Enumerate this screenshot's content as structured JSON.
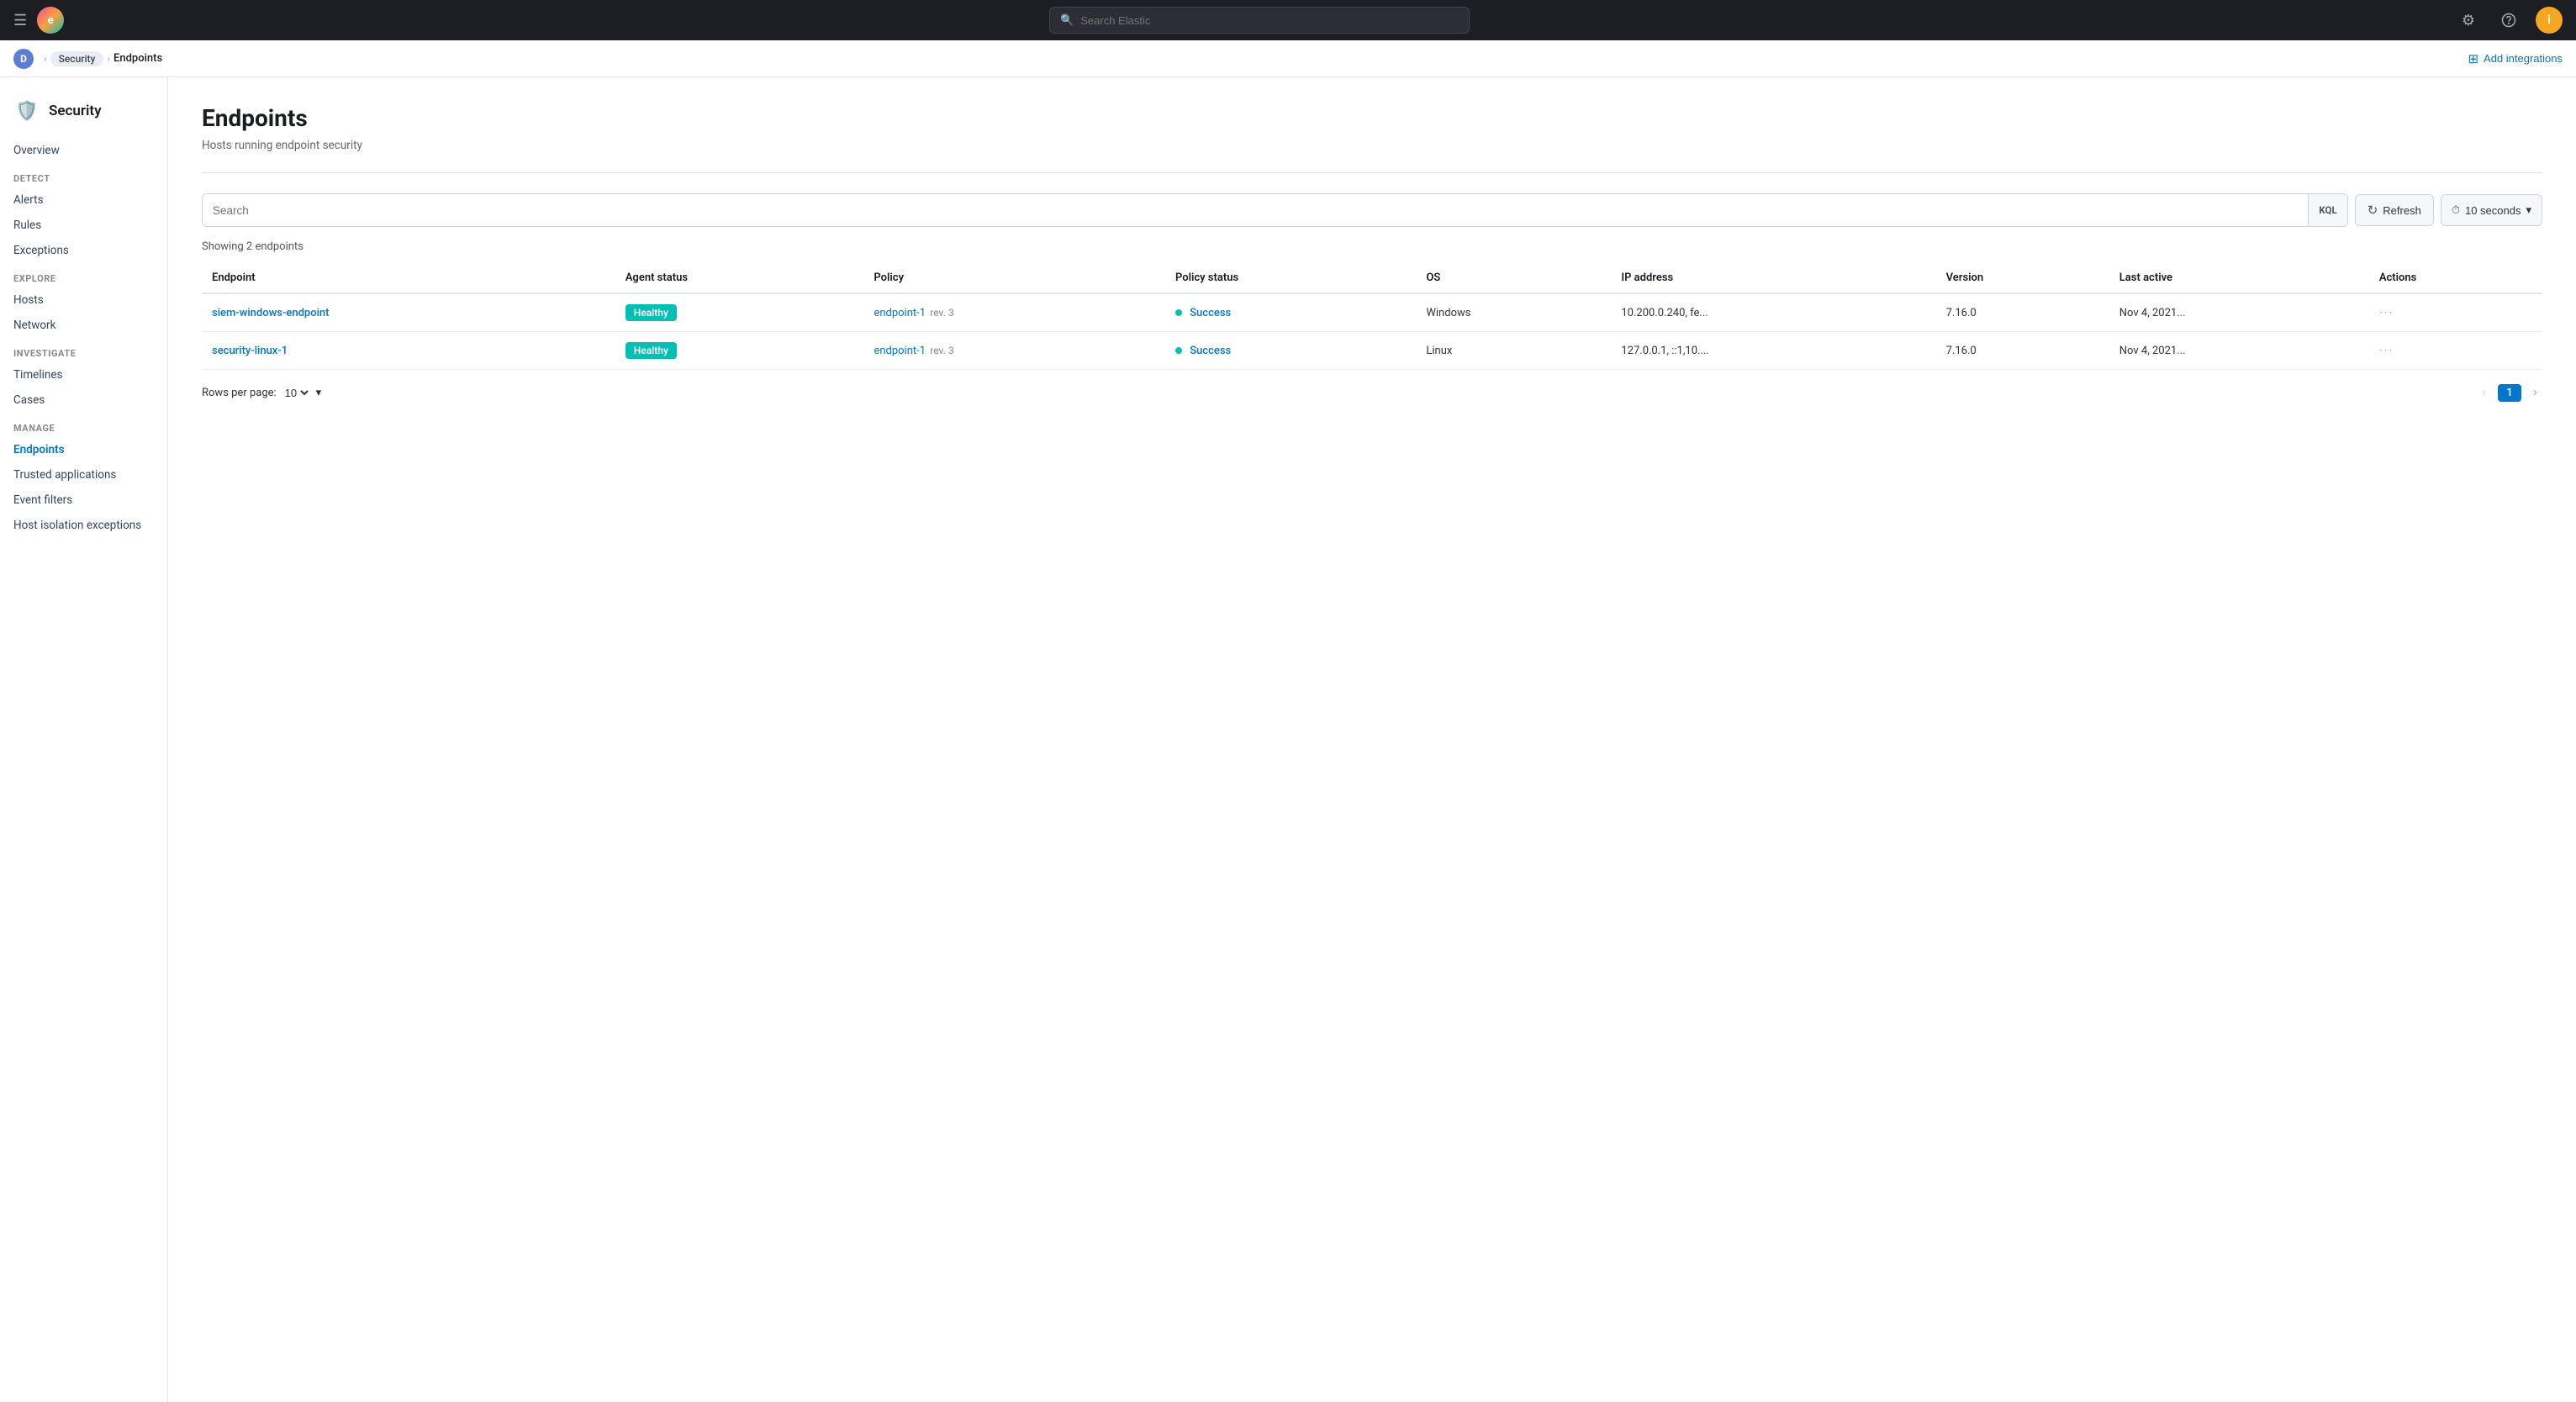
{
  "topnav": {
    "search_placeholder": "Search Elastic",
    "hamburger_icon": "☰",
    "logo_initials": "e",
    "settings_icon": "⚙",
    "support_icon": "☁",
    "user_avatar": "i"
  },
  "breadcrumb": {
    "home_icon": "D",
    "items": [
      {
        "label": "Security",
        "active": false
      },
      {
        "label": "Endpoints",
        "active": true
      }
    ],
    "add_integrations_label": "Add integrations",
    "add_integrations_icon": "⊞"
  },
  "sidebar": {
    "title": "Security",
    "shield_icon": "🛡",
    "overview_label": "Overview",
    "sections": [
      {
        "label": "Detect",
        "items": [
          {
            "id": "alerts",
            "label": "Alerts"
          },
          {
            "id": "rules",
            "label": "Rules"
          },
          {
            "id": "exceptions",
            "label": "Exceptions"
          }
        ]
      },
      {
        "label": "Explore",
        "items": [
          {
            "id": "hosts",
            "label": "Hosts"
          },
          {
            "id": "network",
            "label": "Network"
          }
        ]
      },
      {
        "label": "Investigate",
        "items": [
          {
            "id": "timelines",
            "label": "Timelines"
          },
          {
            "id": "cases",
            "label": "Cases"
          }
        ]
      },
      {
        "label": "Manage",
        "items": [
          {
            "id": "endpoints",
            "label": "Endpoints",
            "active": true
          },
          {
            "id": "trusted-applications",
            "label": "Trusted applications"
          },
          {
            "id": "event-filters",
            "label": "Event filters"
          },
          {
            "id": "host-isolation-exceptions",
            "label": "Host isolation exceptions"
          }
        ]
      }
    ]
  },
  "main": {
    "title": "Endpoints",
    "subtitle": "Hosts running endpoint security",
    "search_placeholder": "Search",
    "kql_label": "KQL",
    "refresh_label": "Refresh",
    "refresh_icon": "↻",
    "clock_icon": "⏱",
    "time_label": "10 seconds",
    "chevron_down": "▾",
    "showing_label": "Showing 2 endpoints",
    "table": {
      "columns": [
        {
          "id": "endpoint",
          "label": "Endpoint"
        },
        {
          "id": "agent_status",
          "label": "Agent status"
        },
        {
          "id": "policy",
          "label": "Policy"
        },
        {
          "id": "policy_status",
          "label": "Policy status"
        },
        {
          "id": "os",
          "label": "OS"
        },
        {
          "id": "ip_address",
          "label": "IP address"
        },
        {
          "id": "version",
          "label": "Version"
        },
        {
          "id": "last_active",
          "label": "Last active"
        },
        {
          "id": "actions",
          "label": "Actions"
        }
      ],
      "rows": [
        {
          "endpoint": "siem-windows-endpoint",
          "agent_status": "Healthy",
          "policy": "endpoint-1",
          "policy_rev": "rev. 3",
          "policy_status": "Success",
          "os": "Windows",
          "ip_address": "10.200.0.240, fe...",
          "version": "7.16.0",
          "last_active": "Nov 4, 2021...",
          "actions_icon": "···"
        },
        {
          "endpoint": "security-linux-1",
          "agent_status": "Healthy",
          "policy": "endpoint-1",
          "policy_rev": "rev. 3",
          "policy_status": "Success",
          "os": "Linux",
          "ip_address": "127.0.0.1, ::1,10....",
          "version": "7.16.0",
          "last_active": "Nov 4, 2021...",
          "actions_icon": "···"
        }
      ]
    },
    "pagination": {
      "rows_per_page_label": "Rows per page:",
      "rows_per_page_value": "10",
      "current_page": "1",
      "prev_icon": "‹",
      "next_icon": "›"
    }
  }
}
